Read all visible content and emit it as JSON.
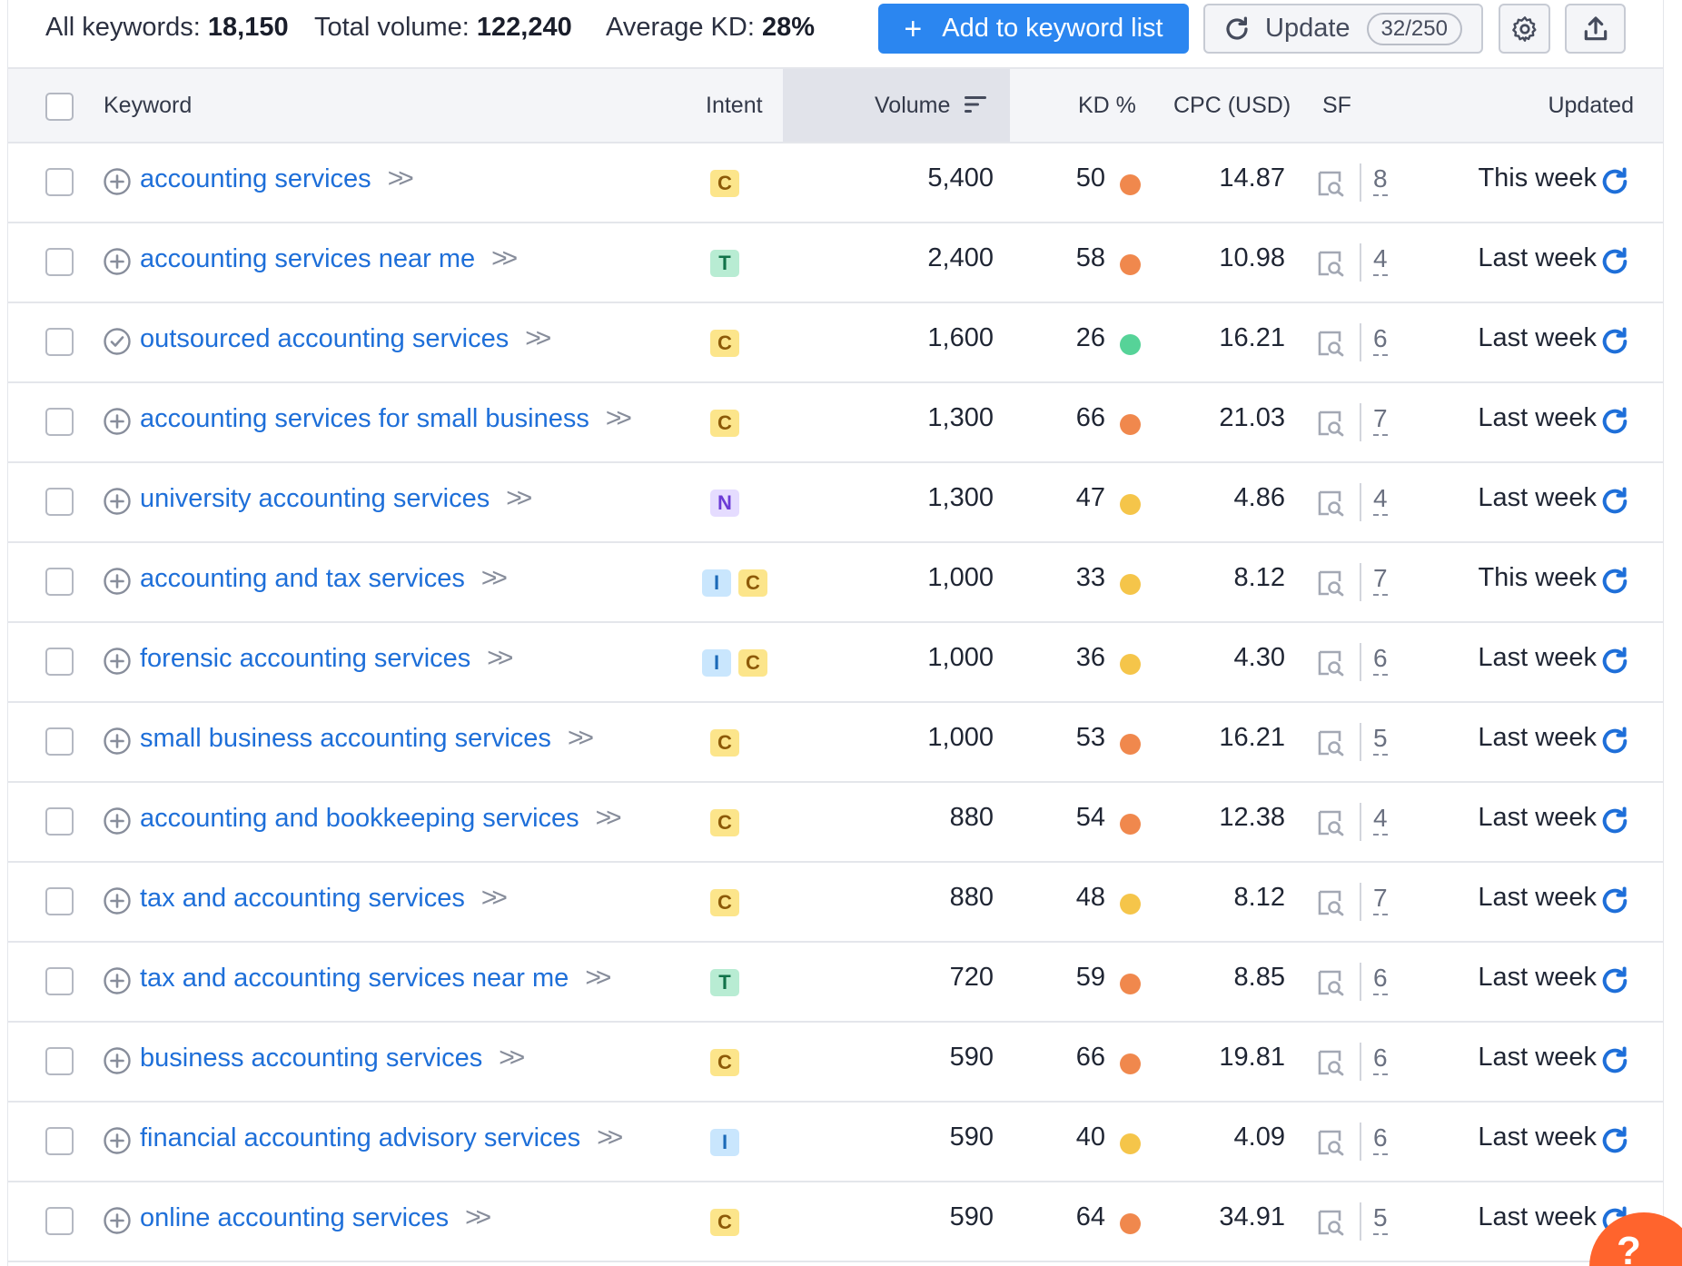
{
  "summary": {
    "all_keywords_label": "All keywords:",
    "all_keywords_value": "18,150",
    "total_volume_label": "Total volume:",
    "total_volume_value": "122,240",
    "average_kd_label": "Average KD:",
    "average_kd_value": "28%"
  },
  "toolbar": {
    "add_label": "Add to keyword list",
    "update_label": "Update",
    "update_count": "32/250",
    "settings_icon": "gear-icon",
    "export_icon": "export-icon"
  },
  "columns": {
    "keyword": "Keyword",
    "intent": "Intent",
    "volume": "Volume",
    "kd": "KD %",
    "cpc": "CPC (USD)",
    "sf": "SF",
    "updated": "Updated"
  },
  "colors": {
    "accent": "#2b86f0",
    "link": "#1e6fd9",
    "kd_hard": "#f0884d",
    "kd_easy": "#56d398",
    "kd_possible": "#f5c54a"
  },
  "rows": [
    {
      "keyword": "accounting services",
      "status": "add",
      "intents": [
        "C"
      ],
      "volume": "5,400",
      "kd": "50",
      "kd_level": "hard",
      "cpc": "14.87",
      "sf": "8",
      "updated": "This week"
    },
    {
      "keyword": "accounting services near me",
      "status": "add",
      "intents": [
        "T"
      ],
      "volume": "2,400",
      "kd": "58",
      "kd_level": "hard",
      "cpc": "10.98",
      "sf": "4",
      "updated": "Last week"
    },
    {
      "keyword": "outsourced accounting services",
      "status": "added",
      "intents": [
        "C"
      ],
      "volume": "1,600",
      "kd": "26",
      "kd_level": "easy",
      "cpc": "16.21",
      "sf": "6",
      "updated": "Last week"
    },
    {
      "keyword": "accounting services for small business",
      "status": "add",
      "intents": [
        "C"
      ],
      "volume": "1,300",
      "kd": "66",
      "kd_level": "hard",
      "cpc": "21.03",
      "sf": "7",
      "updated": "Last week"
    },
    {
      "keyword": "university accounting services",
      "status": "add",
      "intents": [
        "N"
      ],
      "volume": "1,300",
      "kd": "47",
      "kd_level": "possible",
      "cpc": "4.86",
      "sf": "4",
      "updated": "Last week"
    },
    {
      "keyword": "accounting and tax services",
      "status": "add",
      "intents": [
        "I",
        "C"
      ],
      "volume": "1,000",
      "kd": "33",
      "kd_level": "possible",
      "cpc": "8.12",
      "sf": "7",
      "updated": "This week"
    },
    {
      "keyword": "forensic accounting services",
      "status": "add",
      "intents": [
        "I",
        "C"
      ],
      "volume": "1,000",
      "kd": "36",
      "kd_level": "possible",
      "cpc": "4.30",
      "sf": "6",
      "updated": "Last week"
    },
    {
      "keyword": "small business accounting services",
      "status": "add",
      "intents": [
        "C"
      ],
      "volume": "1,000",
      "kd": "53",
      "kd_level": "hard",
      "cpc": "16.21",
      "sf": "5",
      "updated": "Last week"
    },
    {
      "keyword": "accounting and bookkeeping services",
      "status": "add",
      "intents": [
        "C"
      ],
      "volume": "880",
      "kd": "54",
      "kd_level": "hard",
      "cpc": "12.38",
      "sf": "4",
      "updated": "Last week"
    },
    {
      "keyword": "tax and accounting services",
      "status": "add",
      "intents": [
        "C"
      ],
      "volume": "880",
      "kd": "48",
      "kd_level": "possible",
      "cpc": "8.12",
      "sf": "7",
      "updated": "Last week"
    },
    {
      "keyword": "tax and accounting services near me",
      "status": "add",
      "intents": [
        "T"
      ],
      "volume": "720",
      "kd": "59",
      "kd_level": "hard",
      "cpc": "8.85",
      "sf": "6",
      "updated": "Last week"
    },
    {
      "keyword": "business accounting services",
      "status": "add",
      "intents": [
        "C"
      ],
      "volume": "590",
      "kd": "66",
      "kd_level": "hard",
      "cpc": "19.81",
      "sf": "6",
      "updated": "Last week"
    },
    {
      "keyword": "financial accounting advisory services",
      "status": "add",
      "intents": [
        "I"
      ],
      "volume": "590",
      "kd": "40",
      "kd_level": "possible",
      "cpc": "4.09",
      "sf": "6",
      "updated": "Last week"
    },
    {
      "keyword": "online accounting services",
      "status": "add",
      "intents": [
        "C"
      ],
      "volume": "590",
      "kd": "64",
      "kd_level": "hard",
      "cpc": "34.91",
      "sf": "5",
      "updated": "Last week"
    }
  ],
  "help": {
    "label": "?"
  }
}
